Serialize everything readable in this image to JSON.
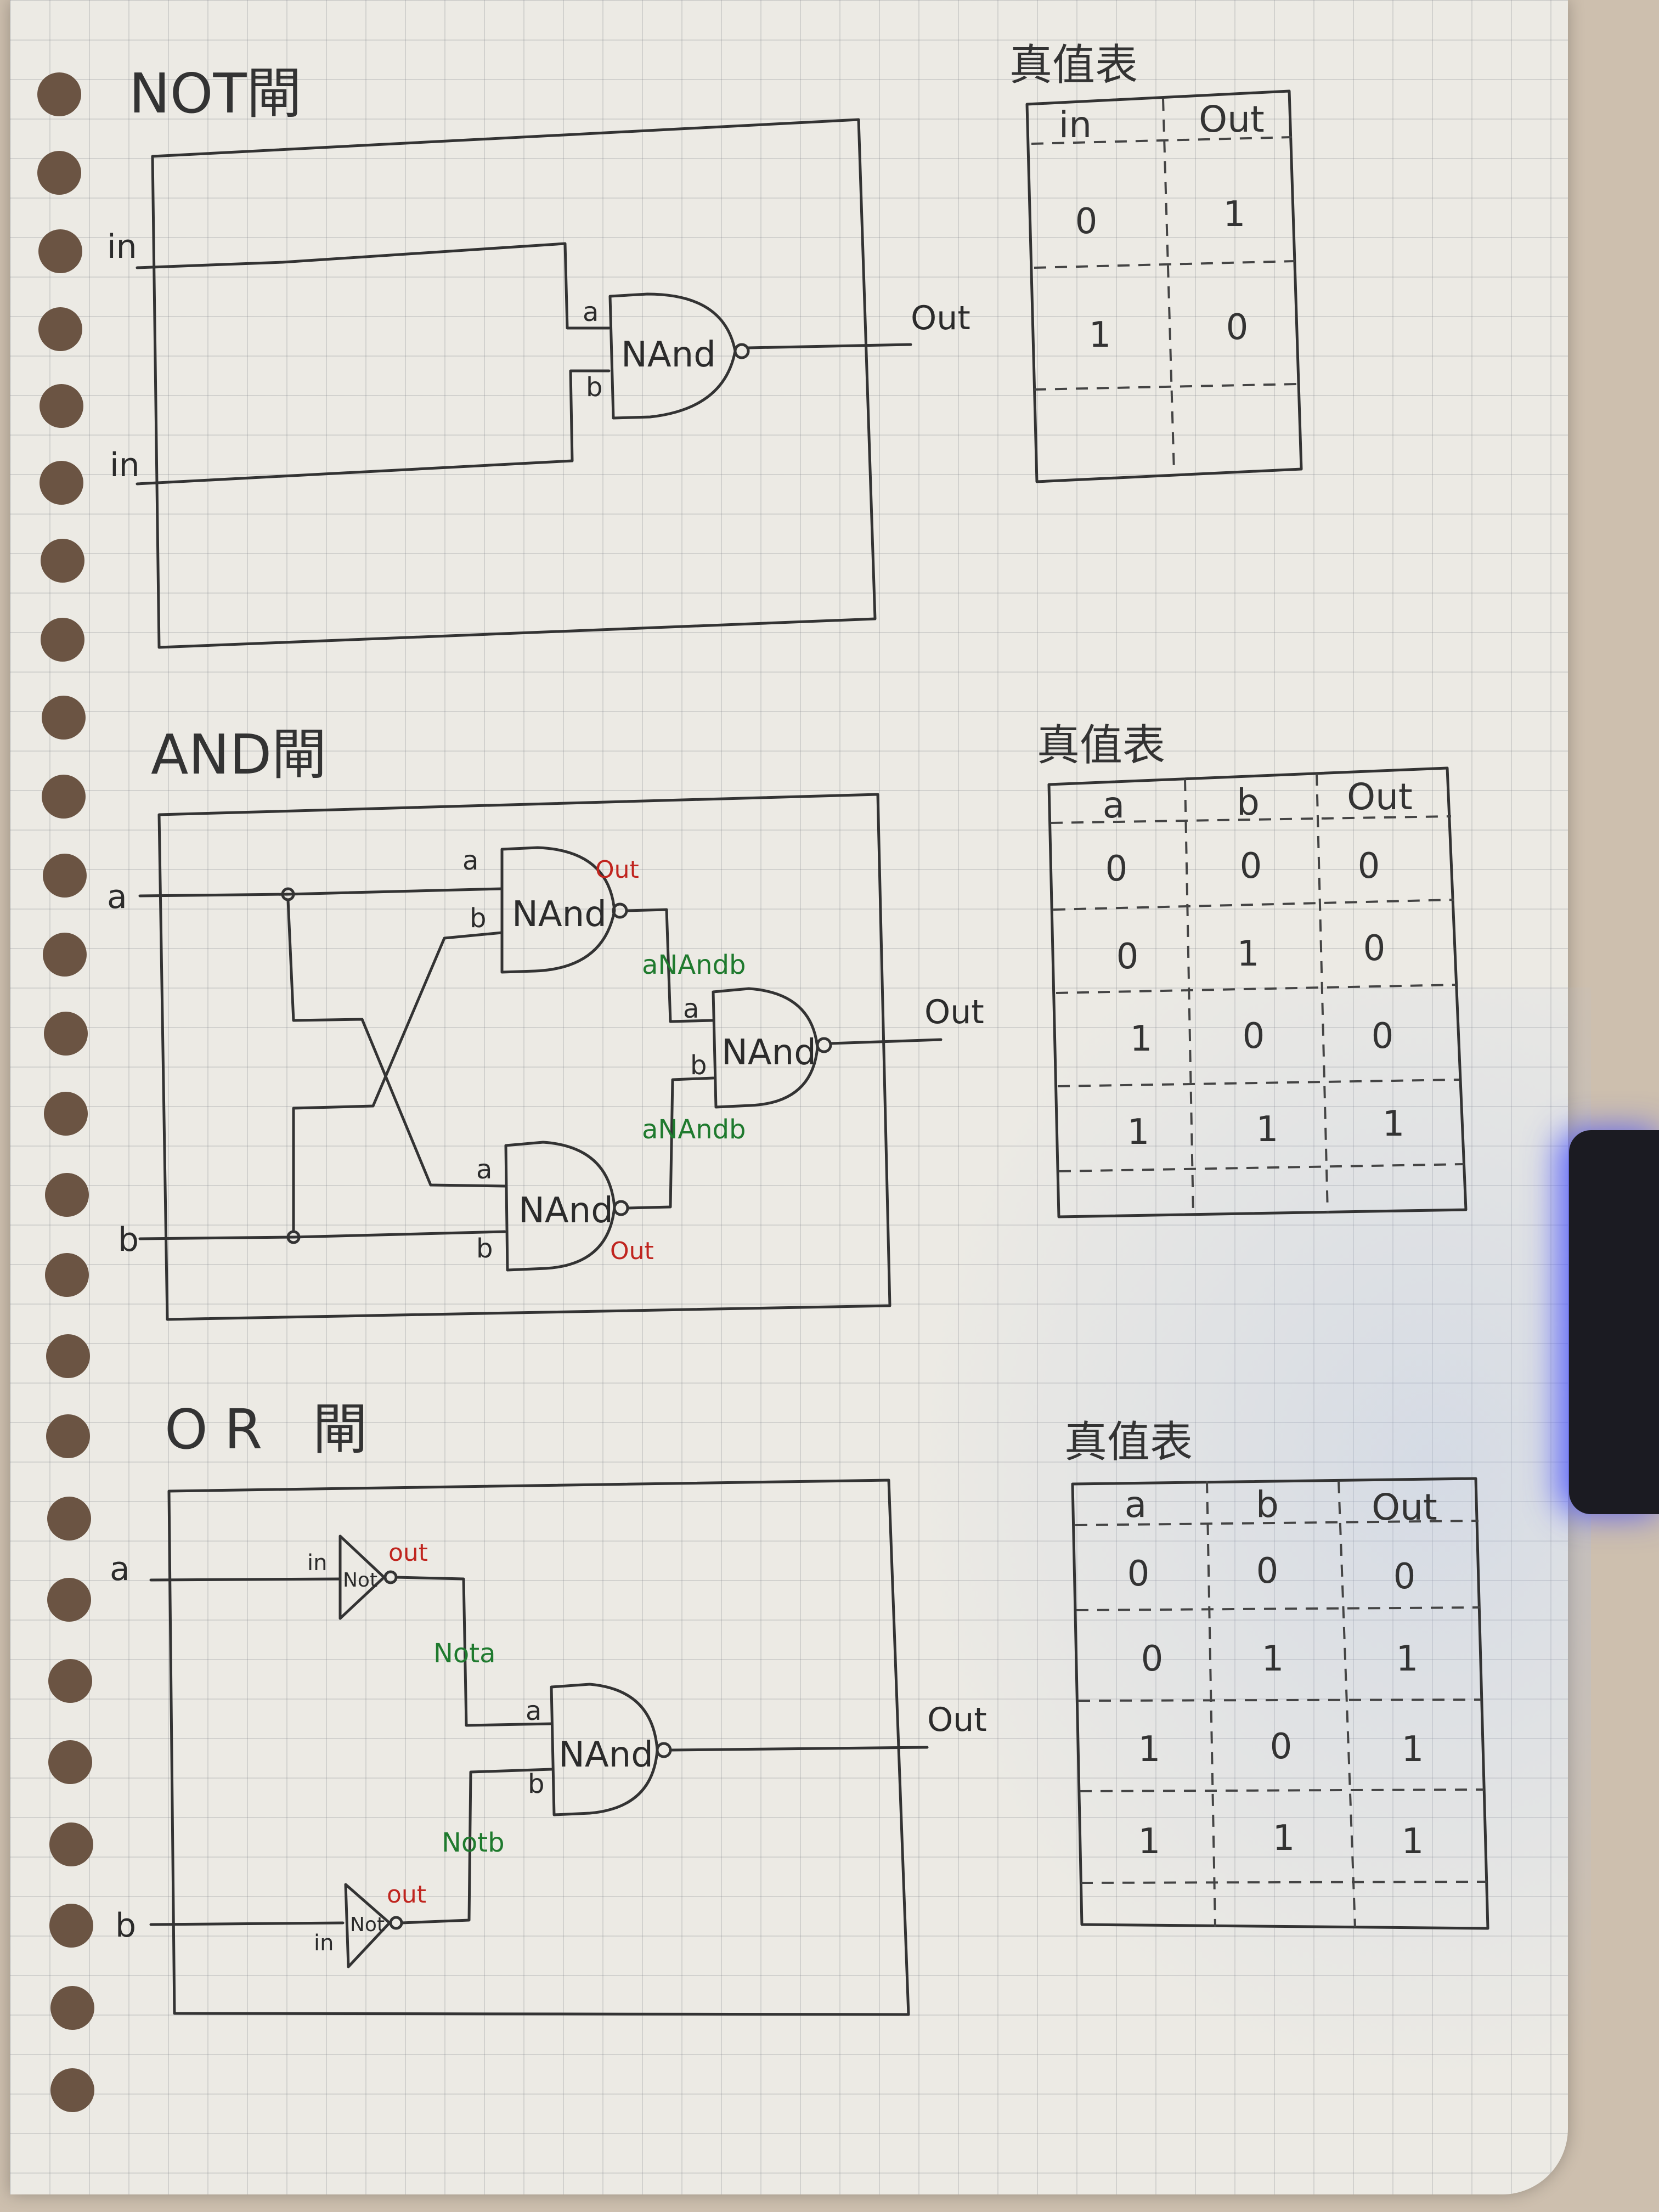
{
  "not_gate": {
    "title": "NOT閘",
    "input_label_1": "in",
    "input_label_2": "in",
    "pin_a": "a",
    "pin_b": "b",
    "gate_label": "NAnd",
    "output_label": "Out",
    "truth_table": {
      "title": "真值表",
      "headers": [
        "in",
        "Out"
      ],
      "rows": [
        [
          "0",
          "1"
        ],
        [
          "1",
          "0"
        ]
      ]
    }
  },
  "and_gate": {
    "title": "AND閘",
    "input_a": "a",
    "input_b": "b",
    "nand1": {
      "label": "NAnd",
      "pin_a": "a",
      "pin_b": "b",
      "out": "Out"
    },
    "nand2": {
      "label": "NAnd",
      "pin_a": "a",
      "pin_b": "b",
      "out": "Out"
    },
    "nand3": {
      "label": "NAnd",
      "pin_a": "a",
      "pin_b": "b"
    },
    "wire_label_1": "aNAndb",
    "wire_label_2": "aNAndb",
    "output_label": "Out",
    "truth_table": {
      "title": "真值表",
      "headers": [
        "a",
        "b",
        "Out"
      ],
      "rows": [
        [
          "0",
          "0",
          "0"
        ],
        [
          "0",
          "1",
          "0"
        ],
        [
          "1",
          "0",
          "0"
        ],
        [
          "1",
          "1",
          "1"
        ]
      ]
    }
  },
  "or_gate": {
    "title": "OR 閘",
    "input_a": "a",
    "input_b": "b",
    "not1": {
      "label": "Not",
      "in": "in",
      "out": "out"
    },
    "not2": {
      "label": "Not",
      "in": "in",
      "out": "out"
    },
    "wire_label_1": "Nota",
    "wire_label_2": "Notb",
    "nand": {
      "label": "NAnd",
      "pin_a": "a",
      "pin_b": "b"
    },
    "output_label": "Out",
    "truth_table": {
      "title": "真值表",
      "headers": [
        "a",
        "b",
        "Out"
      ],
      "rows": [
        [
          "0",
          "0",
          "0"
        ],
        [
          "0",
          "1",
          "1"
        ],
        [
          "1",
          "0",
          "1"
        ],
        [
          "1",
          "1",
          "1"
        ]
      ]
    }
  },
  "colors": {
    "paper": "#eceae4",
    "ink": "#333333",
    "red_ink": "#c0251f",
    "green_ink": "#1f7a2e"
  }
}
